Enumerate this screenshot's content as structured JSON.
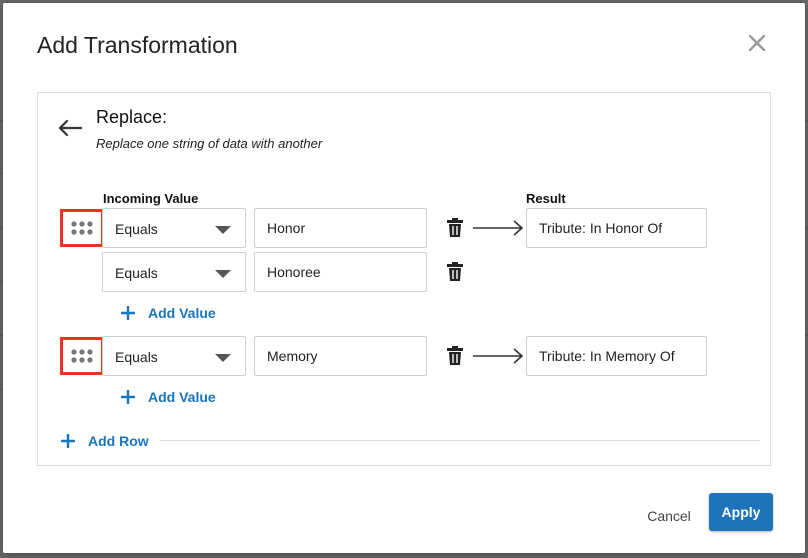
{
  "dialog": {
    "title": "Add Transformation",
    "close_icon": "close-icon"
  },
  "card": {
    "back_icon": "arrow-left-icon",
    "title": "Replace:",
    "subtitle": "Replace one string of data with another",
    "incoming_label": "Incoming Value",
    "result_label": "Result"
  },
  "rows": [
    {
      "conditions": [
        {
          "operator": "Equals",
          "value": "Honor"
        },
        {
          "operator": "Equals",
          "value": "Honoree"
        }
      ],
      "result": "Tribute: In Honor Of",
      "add_value_label": "Add Value"
    },
    {
      "conditions": [
        {
          "operator": "Equals",
          "value": "Memory"
        }
      ],
      "result": "Tribute: In Memory Of",
      "add_value_label": "Add Value"
    }
  ],
  "add_row_label": "Add Row",
  "footer": {
    "cancel_label": "Cancel",
    "apply_label": "Apply"
  },
  "colors": {
    "accent": "#1e73b9",
    "link": "#1a75bb",
    "highlight": "#e8321e"
  }
}
